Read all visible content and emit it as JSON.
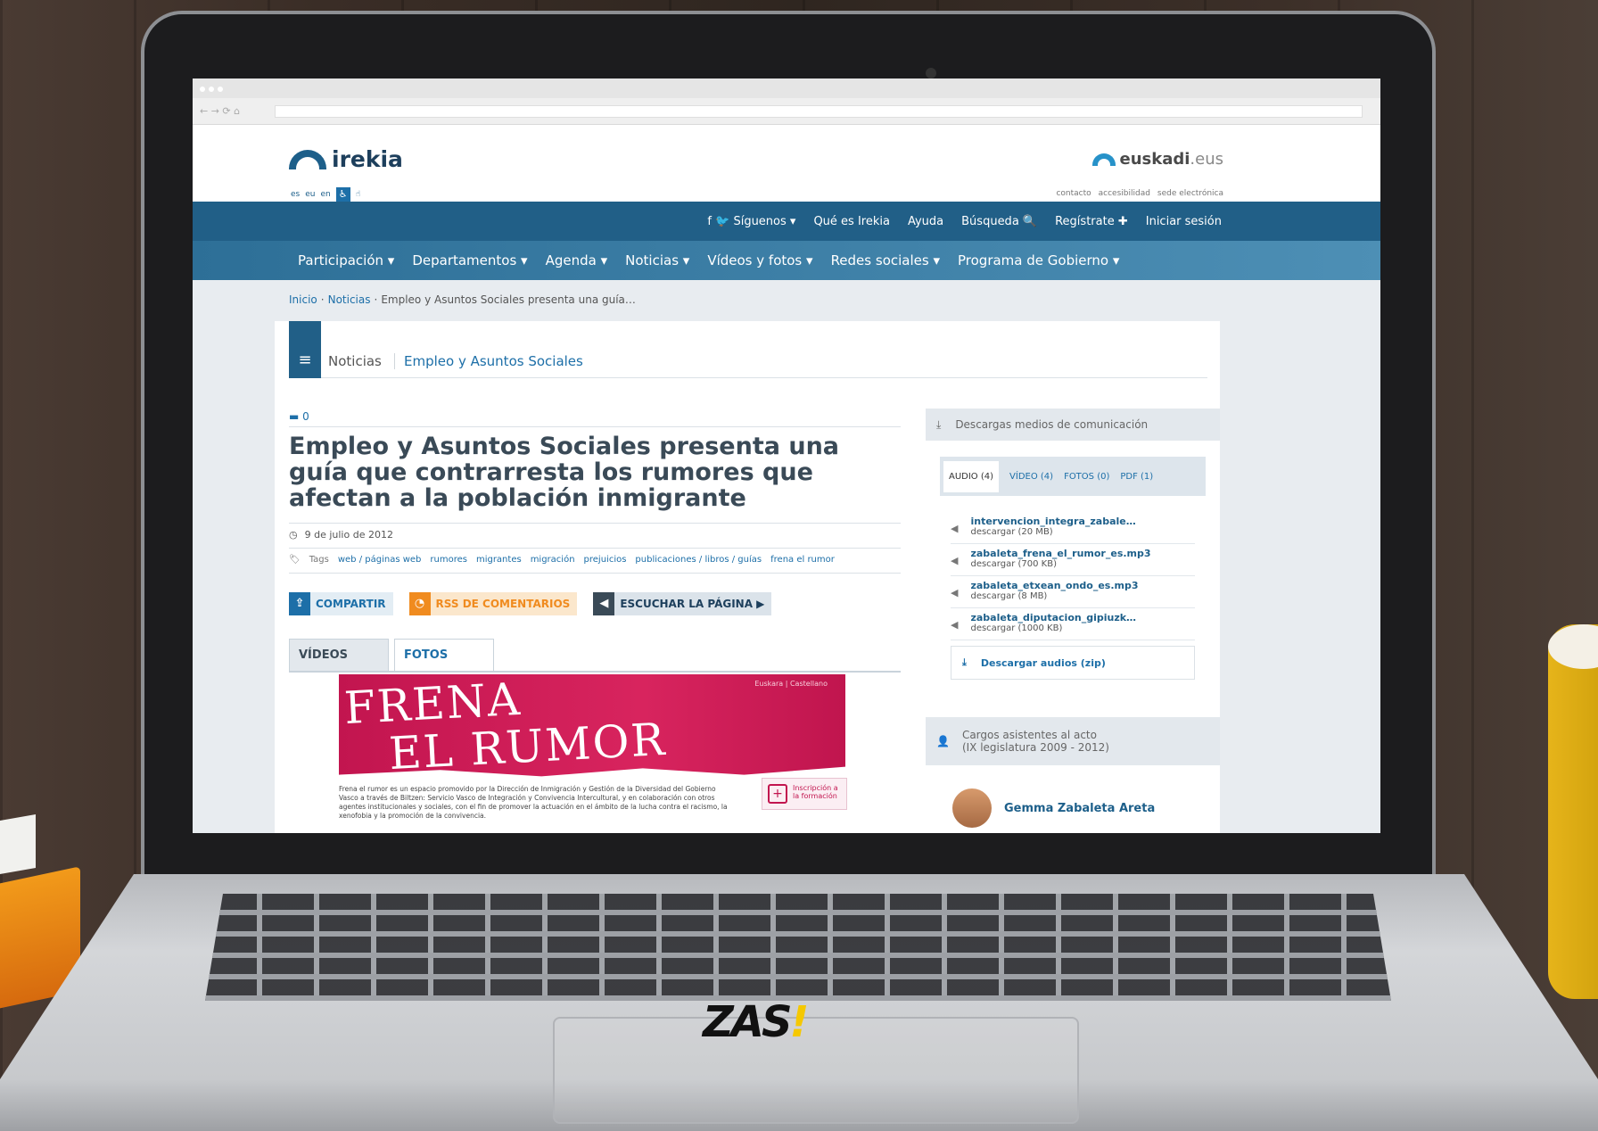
{
  "site": {
    "logo": "irekia",
    "euskadi_logo": "euskadi",
    "euskadi_ext": ".eus",
    "languages": [
      "es",
      "eu",
      "en"
    ],
    "util_links": [
      "contacto",
      "accesibilidad",
      "sede electrónica"
    ]
  },
  "nav_top": [
    "Síguenos",
    "Qué es Irekia",
    "Ayuda",
    "Búsqueda",
    "Regístrate",
    "Iniciar sesión"
  ],
  "nav_main": [
    "Participación",
    "Departamentos",
    "Agenda",
    "Noticias",
    "Vídeos y fotos",
    "Redes sociales",
    "Programa de Gobierno"
  ],
  "breadcrumb": {
    "home": "Inicio",
    "section": "Noticias",
    "current": "Empleo y Asuntos Sociales presenta una guía…"
  },
  "section": {
    "label": "Noticias",
    "sub": "Empleo y Asuntos Sociales"
  },
  "article": {
    "comments": "0",
    "title": "Empleo y Asuntos Sociales presenta una guía que contrarresta los rumores que afectan a la población inmigrante",
    "date": "9 de julio de 2012",
    "tags_label": "Tags",
    "tags": [
      "web / páginas web",
      "rumores",
      "migrantes",
      "migración",
      "prejuicios",
      "publicaciones / libros / guías",
      "frena el rumor"
    ],
    "share_label": "COMPARTIR",
    "rss_label": "RSS DE COMENTARIOS",
    "listen_label": "ESCUCHAR LA PÁGINA ▶",
    "tab_videos": "VÍDEOS",
    "tab_photos": "FOTOS"
  },
  "banner": {
    "line1": "FRENA",
    "line2": "EL RUMOR",
    "links": "Euskara  |  Castellano",
    "text": "Frena el rumor es un espacio promovido por la Dirección de Inmigración y Gestión de la Diversidad del Gobierno Vasco a través de Biltzen: Servicio Vasco de Integración y Convivencia Intercultural, y en colaboración con otros agentes institucionales y sociales, con el fin de promover la actuación en el ámbito de la lucha contra el racismo, la xenofobia y la promoción de la convivencia.",
    "cta": "Inscripción a la formación"
  },
  "sidebar": {
    "downloads_title": "Descargas medios de comunicación",
    "tabs": [
      "AUDIO (4)",
      "VÍDEO (4)",
      "FOTOS (0)",
      "PDF (1)"
    ],
    "files": [
      {
        "name": "intervencion_integra_zabale…",
        "size": "descargar (20 MB)"
      },
      {
        "name": "zabaleta_frena_el_rumor_es.mp3",
        "size": "descargar (700 KB)"
      },
      {
        "name": "zabaleta_etxean_ondo_es.mp3",
        "size": "descargar (8 MB)"
      },
      {
        "name": "zabaleta_diputacion_gipiuzk…",
        "size": "descargar (1000 KB)"
      }
    ],
    "zip_label": "Descargar audios (zip)",
    "attendees_title": "Cargos asistentes al acto",
    "attendees_sub": "(IX legislatura 2009 - 2012)",
    "person": "Gemma Zabaleta Areta"
  },
  "watermark": {
    "text": "ZAS",
    "bang": "!"
  }
}
